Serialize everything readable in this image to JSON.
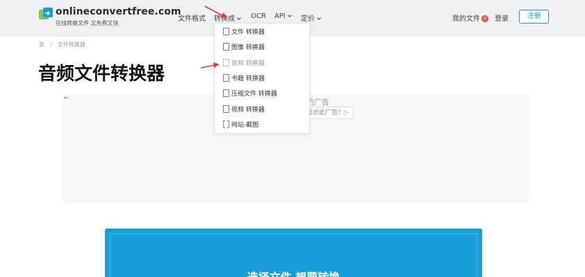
{
  "header": {
    "brand": "onlineconvertfree.com",
    "tagline": "在线转换文件 又免费又快",
    "nav": [
      "文件格式",
      "转换成",
      "OCR",
      "API",
      "定价"
    ],
    "my_docs": "我的文件",
    "my_docs_count": "0",
    "login": "登录",
    "register": "注册"
  },
  "breadcrumb": [
    "家",
    "文件转换器"
  ],
  "page_title": "音频文件转换器",
  "ad": {
    "back": "←",
    "title": "的广告",
    "why": "显示此广告?",
    "play": "▷"
  },
  "dropdown": {
    "items": [
      "文件 转换器",
      "图像 转换器",
      "音频 转换器",
      "书籍 转换器",
      "压缩文件 转换器",
      "视频 转换器",
      "网站-截图"
    ]
  },
  "upload": {
    "label": "选择文件 想要转换"
  },
  "colors": {
    "accent": "#1a9ed8",
    "arrow": "#e53935",
    "badge": "#e74c3c"
  }
}
